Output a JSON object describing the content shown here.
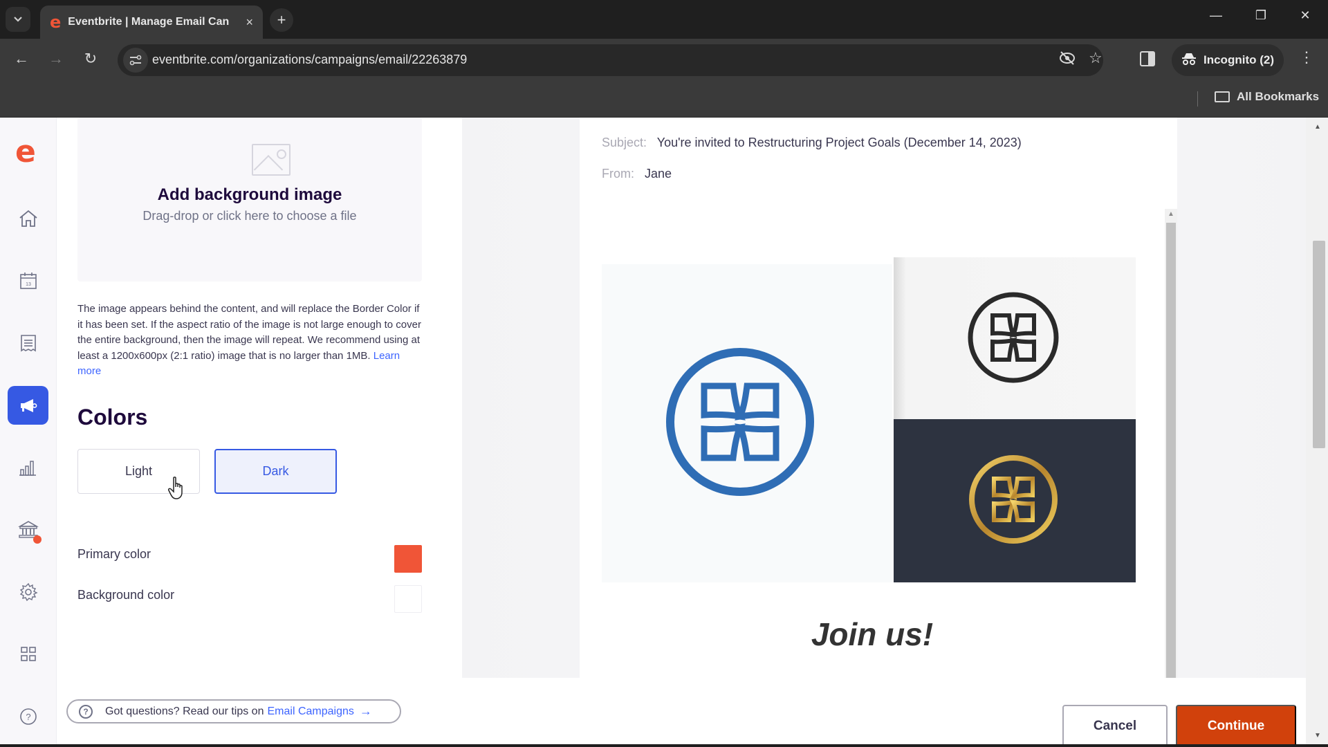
{
  "browser": {
    "tab_title": "Eventbrite | Manage Email Can",
    "favicon": "e",
    "url": "eventbrite.com/organizations/campaigns/email/22263879",
    "incognito_label": "Incognito (2)",
    "bookmarks_label": "All Bookmarks",
    "icons": {
      "tab_menu": "chevron-down",
      "tab_close": "×",
      "new_tab": "+",
      "back": "←",
      "forward": "→",
      "reload": "↻",
      "site_info": "⚌",
      "eye_off": "◎",
      "star": "☆",
      "kebab": "⋮",
      "minimize": "—",
      "restore": "❐",
      "close": "✕"
    }
  },
  "sidebar": {
    "logo": "e",
    "items": [
      {
        "name": "home",
        "active": false
      },
      {
        "name": "events",
        "active": false
      },
      {
        "name": "orders",
        "active": false
      },
      {
        "name": "marketing",
        "active": true
      },
      {
        "name": "reports",
        "active": false
      },
      {
        "name": "finance",
        "active": false,
        "badge": true
      },
      {
        "name": "settings",
        "active": false
      },
      {
        "name": "app-marketplace",
        "active": false
      },
      {
        "name": "help",
        "active": false
      }
    ]
  },
  "panel": {
    "dropzone": {
      "title": "Add background image",
      "subtitle": "Drag-drop or click here to choose a file"
    },
    "help_text": "The image appears behind the content, and will replace the Border Color if it has been set. If the aspect ratio of the image is not large enough to cover the entire background, then the image will repeat. We recommend using at least a 1200x600px (2:1 ratio) image that is no larger than 1MB.",
    "learn_more": "Learn more",
    "colors_title": "Colors",
    "modes": {
      "light": "Light",
      "dark": "Dark",
      "selected": "Dark"
    },
    "primary_color_label": "Primary color",
    "primary_color_value": "#f05537",
    "background_color_label": "Background color",
    "background_color_value": "#ffffff",
    "tips": {
      "text": "Got questions? Read our tips on",
      "link": "Email Campaigns",
      "arrow": "→"
    }
  },
  "preview": {
    "subject_label": "Subject:",
    "subject": "You're invited to Restructuring Project Goals (December 14, 2023)",
    "from_label": "From:",
    "from": "Jane",
    "heading": "Join us!",
    "logo_colors": {
      "blue": "#2f6db5",
      "black": "#2a2a2a",
      "gold": "#c9a23a",
      "dark_bg": "#2d3340"
    }
  },
  "actions": {
    "cancel": "Cancel",
    "continue": "Continue"
  }
}
